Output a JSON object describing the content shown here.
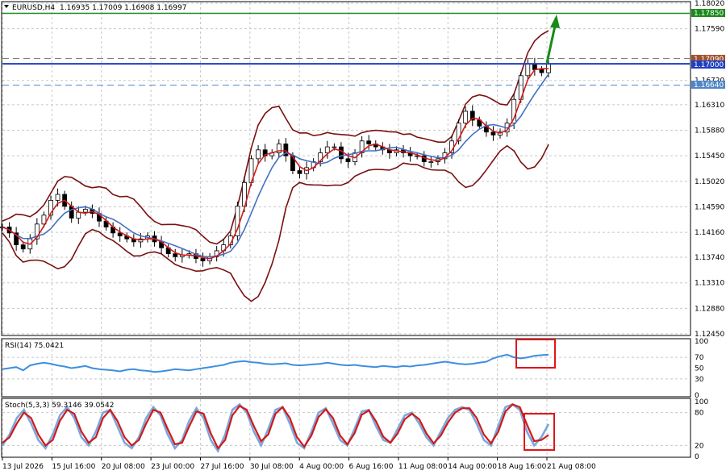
{
  "window": {
    "title": "EURUSD,H4",
    "ohlc": "1.16935 1.17009 1.16908 1.16997"
  },
  "colors": {
    "up": "#000000",
    "grid": "#c8c8c8",
    "target": "#1a8a1a",
    "current": "#1f3fbf",
    "resistance": "#808080",
    "support": "#4f86c6",
    "bollinger": "#7a1010",
    "fast_ma": "#d01a1a",
    "slow_ma": "#4472c4",
    "rsi": "#3d8fe0",
    "stoch_main": "#7ba7dc",
    "stoch_signal": "#d01a1a",
    "highlight": "#e0151a",
    "arrow": "#1a8a1a"
  },
  "price_levels": {
    "target": {
      "value": 1.1785,
      "label": "1.17850"
    },
    "current": {
      "value": 1.17,
      "label": "1.17000"
    },
    "resistance": {
      "value": 1.1709,
      "label": "1.17090"
    },
    "support": {
      "value": 1.1664,
      "label": "1.16640"
    }
  },
  "chart_data": [
    {
      "type": "candlestick",
      "title": "EURUSD,H4",
      "ylim": [
        1.1245,
        1.1802
      ],
      "y_ticks": [
        "1.18020",
        "1.17590",
        "1.16720",
        "1.16310",
        "1.15880",
        "1.15450",
        "1.15020",
        "1.14590",
        "1.14160",
        "1.13740",
        "1.13310",
        "1.12880",
        "1.12450"
      ],
      "x_ticks": [
        "13 Jul 2026",
        "15 Jul 16:00",
        "20 Jul 08:00",
        "23 Jul 00:00",
        "27 Jul 16:00",
        "30 Jul 08:00",
        "4 Aug 00:00",
        "6 Aug 16:00",
        "11 Aug 08:00",
        "14 Aug 00:00",
        "18 Aug 16:00",
        "21 Aug 08:00"
      ],
      "price_path": [
        1.1425,
        1.1415,
        1.1395,
        1.1388,
        1.1405,
        1.143,
        1.1445,
        1.147,
        1.148,
        1.146,
        1.144,
        1.145,
        1.1455,
        1.1448,
        1.1435,
        1.1425,
        1.1415,
        1.141,
        1.1405,
        1.14,
        1.1405,
        1.141,
        1.14,
        1.139,
        1.138,
        1.1375,
        1.1378,
        1.138,
        1.1372,
        1.1368,
        1.1375,
        1.1385,
        1.1395,
        1.141,
        1.146,
        1.15,
        1.154,
        1.1555,
        1.1545,
        1.155,
        1.1565,
        1.1545,
        1.152,
        1.1515,
        1.1525,
        1.1535,
        1.155,
        1.156,
        1.156,
        1.154,
        1.1535,
        1.155,
        1.157,
        1.1565,
        1.156,
        1.1555,
        1.155,
        1.1555,
        1.155,
        1.1545,
        1.1545,
        1.1535,
        1.1535,
        1.154,
        1.155,
        1.157,
        1.16,
        1.162,
        1.1605,
        1.1595,
        1.1585,
        1.158,
        1.1585,
        1.16,
        1.164,
        1.168,
        1.17,
        1.169,
        1.1685,
        1.17
      ],
      "indicators": [
        "Bollinger Bands",
        "Moving Average (fast)",
        "Moving Average (slow)"
      ],
      "grid": true
    },
    {
      "type": "line",
      "title": "RSI(14) 75.0421",
      "ylim": [
        0,
        100
      ],
      "y_ticks": [
        "100",
        "70",
        "50",
        "30",
        "0"
      ],
      "values": [
        48,
        50,
        52,
        46,
        55,
        58,
        60,
        58,
        55,
        53,
        50,
        52,
        54,
        50,
        48,
        47,
        46,
        44,
        47,
        48,
        46,
        45,
        43,
        44,
        46,
        48,
        47,
        46,
        48,
        50,
        52,
        54,
        56,
        60,
        62,
        63,
        61,
        60,
        58,
        57,
        58,
        59,
        56,
        55,
        56,
        57,
        58,
        60,
        58,
        56,
        55,
        56,
        54,
        53,
        52,
        54,
        53,
        52,
        54,
        53,
        55,
        56,
        58,
        60,
        62,
        60,
        58,
        57,
        58,
        60,
        62,
        68,
        72,
        75,
        70,
        68,
        70,
        73,
        74,
        75
      ]
    },
    {
      "type": "line",
      "title": "Stoch(5,3,3) 59.3146 39.0542",
      "ylim": [
        0,
        100
      ],
      "y_ticks": [
        "100",
        "80",
        "20",
        "0"
      ],
      "series": [
        {
          "name": "59.3146",
          "values": [
            20,
            40,
            70,
            85,
            60,
            30,
            15,
            40,
            75,
            90,
            70,
            35,
            20,
            45,
            80,
            85,
            55,
            25,
            15,
            35,
            70,
            90,
            75,
            40,
            15,
            30,
            65,
            88,
            70,
            30,
            10,
            40,
            85,
            95,
            80,
            45,
            20,
            50,
            85,
            90,
            60,
            25,
            15,
            45,
            80,
            88,
            60,
            30,
            20,
            50,
            82,
            85,
            55,
            30,
            25,
            50,
            75,
            80,
            60,
            35,
            20,
            45,
            70,
            85,
            90,
            85,
            60,
            30,
            20,
            55,
            90,
            95,
            85,
            45,
            20,
            35,
            59
          ]
        },
        {
          "name": "39.0542",
          "values": [
            25,
            35,
            60,
            80,
            70,
            40,
            20,
            30,
            65,
            85,
            78,
            45,
            25,
            35,
            70,
            85,
            65,
            35,
            20,
            30,
            60,
            85,
            80,
            50,
            22,
            25,
            55,
            82,
            78,
            42,
            15,
            30,
            75,
            92,
            85,
            55,
            28,
            40,
            78,
            90,
            70,
            35,
            18,
            38,
            72,
            86,
            70,
            38,
            22,
            42,
            76,
            84,
            64,
            36,
            25,
            42,
            68,
            78,
            68,
            42,
            24,
            38,
            62,
            80,
            88,
            88,
            70,
            40,
            24,
            45,
            82,
            95,
            90,
            58,
            28,
            30,
            39
          ]
        }
      ]
    }
  ]
}
